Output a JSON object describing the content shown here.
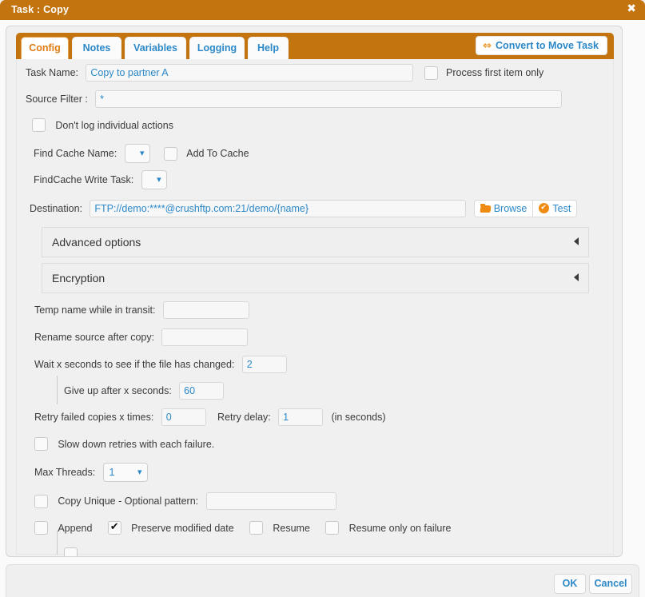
{
  "window": {
    "title": "Task : Copy",
    "close_label": "✖",
    "accent_color": "#c4740e",
    "link_color": "#2b88c8",
    "active_tab_color": "#e07b12",
    "panel_bg": "#f0f0f0"
  },
  "tabs": [
    {
      "label": "Config",
      "active": true
    },
    {
      "label": "Notes",
      "active": false
    },
    {
      "label": "Variables",
      "active": false
    },
    {
      "label": "Logging",
      "active": false
    },
    {
      "label": "Help",
      "active": false
    }
  ],
  "toolbar": {
    "convert_label": "Convert to Move Task",
    "convert_icon": "swap-horizontal-arrows-icon"
  },
  "form": {
    "task_name": {
      "label": "Task Name:",
      "value": "Copy to partner A",
      "placeholder": ""
    },
    "process_first_item_only": {
      "label": "Process first item only",
      "checked": false
    },
    "source_filter": {
      "label": "Source Filter :",
      "value": "*",
      "placeholder": ""
    },
    "dont_log_individual_actions": {
      "label": "Don't log individual actions",
      "checked": false
    },
    "find_cache_name": {
      "label": "Find Cache Name:",
      "value": ""
    },
    "add_to_cache": {
      "label": "Add To Cache",
      "checked": false
    },
    "findcache_write_task": {
      "label": "FindCache Write Task:",
      "value": ""
    },
    "destination": {
      "label": "Destination:",
      "value": "FTP://demo:****@crushftp.com:21/demo/{name}",
      "placeholder": "",
      "browse_label": "Browse",
      "browse_icon": "folder-open-icon",
      "test_label": "Test",
      "test_icon": "check-circle-icon"
    },
    "sections": [
      {
        "title": "Advanced options",
        "expanded": false,
        "arrow_icon": "chevron-left-icon"
      },
      {
        "title": "Encryption",
        "expanded": false,
        "arrow_icon": "chevron-left-icon"
      }
    ],
    "temp_name": {
      "label": "Temp name while in transit:",
      "value": ""
    },
    "rename_source": {
      "label": "Rename source after copy:",
      "value": ""
    },
    "wait_seconds": {
      "label": "Wait x seconds to see if the file has changed:",
      "value": "2"
    },
    "give_up_seconds": {
      "label": "Give up after x seconds:",
      "value": "60"
    },
    "retry_failed": {
      "label": "Retry failed copies x times:",
      "value": "0"
    },
    "retry_delay": {
      "label": "Retry delay:",
      "value": "1",
      "suffix": "(in seconds)"
    },
    "slow_down_retries": {
      "label": "Slow down retries with each failure.",
      "checked": false
    },
    "max_threads": {
      "label": "Max Threads:",
      "value": "1"
    },
    "copy_unique": {
      "label": "Copy Unique - Optional pattern:",
      "checked": false,
      "pattern": ""
    },
    "append": {
      "label": "Append",
      "checked": false
    },
    "preserve_date": {
      "label": "Preserve modified date",
      "checked": true
    },
    "resume": {
      "label": "Resume",
      "checked": false
    },
    "resume_fail": {
      "label": "Resume only on failure",
      "checked": false
    }
  },
  "footer": {
    "ok_label": "OK",
    "cancel_label": "Cancel"
  },
  "scrollbar": {
    "up_icon": "triangle-up-icon",
    "down_icon": "triangle-down-icon"
  }
}
